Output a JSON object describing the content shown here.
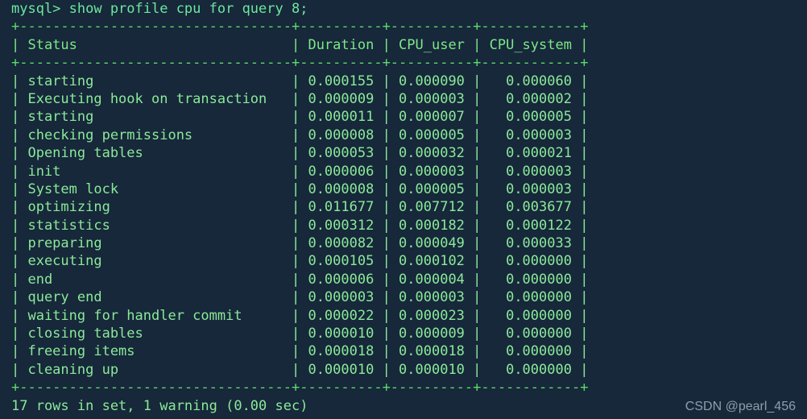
{
  "terminal": {
    "prompt": "mysql>",
    "command": "show profile cpu for query 8;",
    "prompt_line": "mysql> show profile cpu for query 8;",
    "background_color": "#16283a",
    "text_color": "#8ce99a",
    "border_color": "#5ddb6a"
  },
  "table": {
    "columns": [
      {
        "name": "Status",
        "width": 33,
        "align": "left"
      },
      {
        "name": "Duration",
        "width": 10,
        "align": "left"
      },
      {
        "name": "CPU_user",
        "width": 10,
        "align": "left"
      },
      {
        "name": "CPU_system",
        "width": 12,
        "align": "right"
      }
    ],
    "rows": [
      {
        "status": "starting",
        "duration": "0.000155",
        "cpu_user": "0.000090",
        "cpu_system": "0.000060"
      },
      {
        "status": "Executing hook on transaction",
        "duration": "0.000009",
        "cpu_user": "0.000003",
        "cpu_system": "0.000002"
      },
      {
        "status": "starting",
        "duration": "0.000011",
        "cpu_user": "0.000007",
        "cpu_system": "0.000005"
      },
      {
        "status": "checking permissions",
        "duration": "0.000008",
        "cpu_user": "0.000005",
        "cpu_system": "0.000003"
      },
      {
        "status": "Opening tables",
        "duration": "0.000053",
        "cpu_user": "0.000032",
        "cpu_system": "0.000021"
      },
      {
        "status": "init",
        "duration": "0.000006",
        "cpu_user": "0.000003",
        "cpu_system": "0.000003"
      },
      {
        "status": "System lock",
        "duration": "0.000008",
        "cpu_user": "0.000005",
        "cpu_system": "0.000003"
      },
      {
        "status": "optimizing",
        "duration": "0.011677",
        "cpu_user": "0.007712",
        "cpu_system": "0.003677"
      },
      {
        "status": "statistics",
        "duration": "0.000312",
        "cpu_user": "0.000182",
        "cpu_system": "0.000122"
      },
      {
        "status": "preparing",
        "duration": "0.000082",
        "cpu_user": "0.000049",
        "cpu_system": "0.000033"
      },
      {
        "status": "executing",
        "duration": "0.000105",
        "cpu_user": "0.000102",
        "cpu_system": "0.000000"
      },
      {
        "status": "end",
        "duration": "0.000006",
        "cpu_user": "0.000004",
        "cpu_system": "0.000000"
      },
      {
        "status": "query end",
        "duration": "0.000003",
        "cpu_user": "0.000003",
        "cpu_system": "0.000000"
      },
      {
        "status": "waiting for handler commit",
        "duration": "0.000022",
        "cpu_user": "0.000023",
        "cpu_system": "0.000000"
      },
      {
        "status": "closing tables",
        "duration": "0.000010",
        "cpu_user": "0.000009",
        "cpu_system": "0.000000"
      },
      {
        "status": "freeing items",
        "duration": "0.000018",
        "cpu_user": "0.000018",
        "cpu_system": "0.000000"
      },
      {
        "status": "cleaning up",
        "duration": "0.000010",
        "cpu_user": "0.000010",
        "cpu_system": "0.000000"
      }
    ]
  },
  "result_summary": {
    "row_count": 17,
    "warning_count": 1,
    "elapsed": "0.00 sec",
    "text": "17 rows in set, 1 warning (0.00 sec)"
  },
  "watermark": {
    "text": "CSDN @pearl_456"
  }
}
